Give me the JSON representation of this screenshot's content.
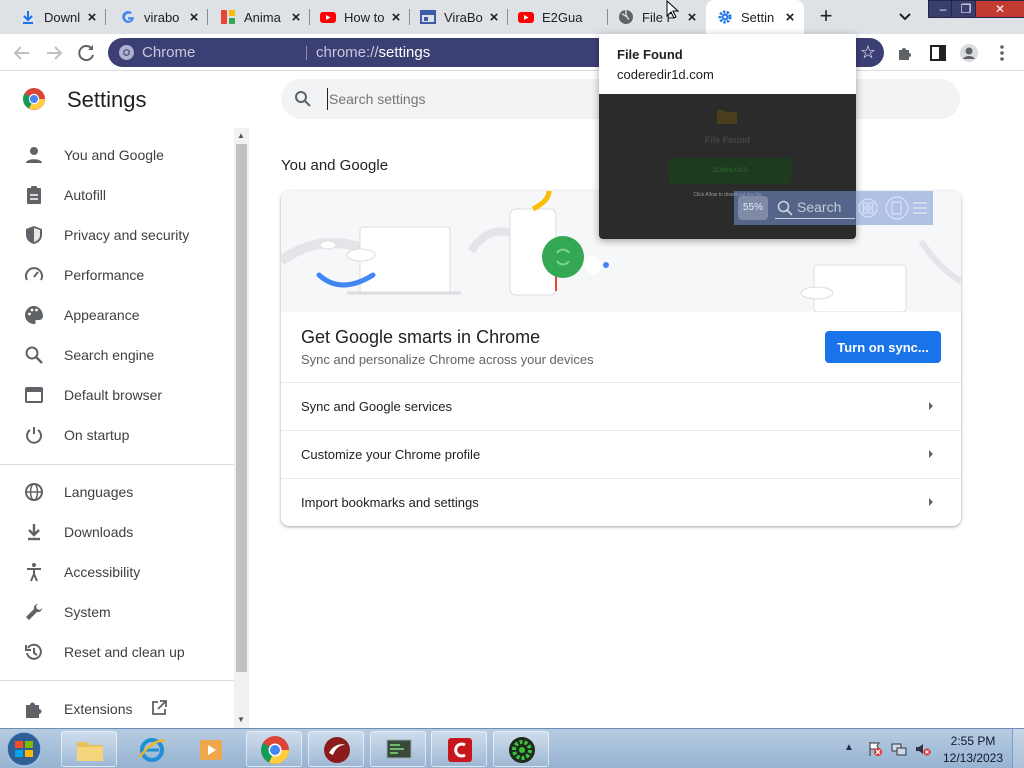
{
  "tabs": [
    {
      "label": "Downl",
      "icon": "download-icon"
    },
    {
      "label": "virabo",
      "icon": "google-icon"
    },
    {
      "label": "Anima",
      "icon": "gallery-icon"
    },
    {
      "label": "How to",
      "icon": "youtube-icon"
    },
    {
      "label": "ViraBo",
      "icon": "window-icon"
    },
    {
      "label": "E2Gua",
      "icon": "youtube-icon"
    },
    {
      "label": "File F",
      "icon": "globe-icon"
    },
    {
      "label": "Settin",
      "icon": "gear-icon",
      "active": true
    }
  ],
  "tab_close": "×",
  "new_tab": "+",
  "omnibox": {
    "chip": "Chrome",
    "url_scheme": "chrome://",
    "url_host": "settings"
  },
  "settings": {
    "title": "Settings",
    "search_placeholder": "Search settings"
  },
  "sidebar": {
    "items": [
      {
        "label": "You and Google",
        "icon": "person-icon"
      },
      {
        "label": "Autofill",
        "icon": "clipboard-icon"
      },
      {
        "label": "Privacy and security",
        "icon": "shield-icon"
      },
      {
        "label": "Performance",
        "icon": "gauge-icon"
      },
      {
        "label": "Appearance",
        "icon": "palette-icon"
      },
      {
        "label": "Search engine",
        "icon": "search-icon"
      },
      {
        "label": "Default browser",
        "icon": "browser-icon"
      },
      {
        "label": "On startup",
        "icon": "power-icon"
      },
      {
        "label": "Languages",
        "icon": "globe-icon"
      },
      {
        "label": "Downloads",
        "icon": "download-icon"
      },
      {
        "label": "Accessibility",
        "icon": "accessibility-icon"
      },
      {
        "label": "System",
        "icon": "wrench-icon"
      },
      {
        "label": "Reset and clean up",
        "icon": "history-icon"
      },
      {
        "label": "Extensions",
        "icon": "puzzle-icon"
      }
    ]
  },
  "main": {
    "section_title": "You and Google",
    "sync_heading": "Get Google smarts in Chrome",
    "sync_sub": "Sync and personalize Chrome across your devices",
    "sync_button": "Turn on sync...",
    "rows": [
      {
        "label": "Sync and Google services"
      },
      {
        "label": "Customize your Chrome profile"
      },
      {
        "label": "Import bookmarks and settings"
      }
    ]
  },
  "hovercard": {
    "title": "File Found",
    "domain": "coderedir1d.com",
    "thumb_title": "File Found",
    "thumb_button": "DOWNLOAD",
    "thumb_note": "Click Allow to download the file"
  },
  "overlay": {
    "percent": "55%",
    "search_label": "Search"
  },
  "window_controls": {
    "minimize": "–",
    "restore": "❐",
    "close": "✕"
  },
  "taskbar": {
    "apps": [
      "explorer-icon",
      "ie-icon",
      "media-player-icon",
      "chrome-icon",
      "red-app-icon",
      "terminal-icon",
      "c-app-icon",
      "gear-app-icon"
    ],
    "time": "2:55 PM",
    "date": "12/13/2023"
  },
  "colors": {
    "accent_blue": "#1a73e8",
    "omnibox_bg": "#3c3f73",
    "tabstrip_bg": "#dee1e6",
    "icon_gray": "#5f6368"
  }
}
